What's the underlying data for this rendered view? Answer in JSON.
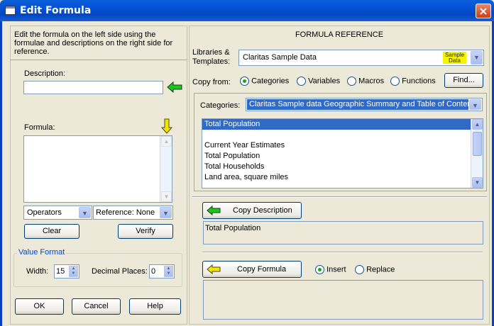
{
  "window": {
    "title": "Edit Formula",
    "close_glyph": "×"
  },
  "left": {
    "instructions": [
      "Edit the formula on the left side using the",
      "formulae and descriptions on the right side for",
      "reference."
    ],
    "description_label": "Description:",
    "description_value": "",
    "formula_label": "Formula:",
    "formula_value": "",
    "operators_select": "Operators",
    "reference_select": "Reference: None",
    "clear_label": "Clear",
    "verify_label": "Verify",
    "value_format_label": "Value Format",
    "width_label": "Width:",
    "width_value": "15",
    "decimal_label": "Decimal Places:",
    "decimal_value": "0",
    "ok_label": "OK",
    "cancel_label": "Cancel",
    "help_label": "Help"
  },
  "right": {
    "heading": "FORMULA REFERENCE",
    "libraries_label": [
      "Libraries &",
      "Templates:"
    ],
    "library_value": "Claritas Sample Data",
    "library_badge": [
      "Sample",
      "Data"
    ],
    "copy_from_label": "Copy from:",
    "copy_from_options": [
      "Categories",
      "Variables",
      "Macros",
      "Functions"
    ],
    "copy_from_selected": "Categories",
    "find_label": "Find...",
    "categories_label": "Categories:",
    "categories_value": "Claritas Sample data  Geographic Summary and Table of Contents",
    "list_items": [
      "Total Population",
      "",
      "Current Year Estimates",
      "Total Population",
      "Total Households",
      "Land area, square miles"
    ],
    "list_selected_index": 0,
    "copy_description_label": "Copy Description",
    "description_preview": "Total Population",
    "copy_formula_label": "Copy Formula",
    "insert_label": "Insert",
    "replace_label": "Replace",
    "insert_mode": "Insert",
    "formula_preview": ""
  },
  "colors": {
    "green_arrow": "#19c919",
    "yellow_arrow": "#f2e600",
    "selection": "#316ac5",
    "badge": "#f4f400"
  }
}
